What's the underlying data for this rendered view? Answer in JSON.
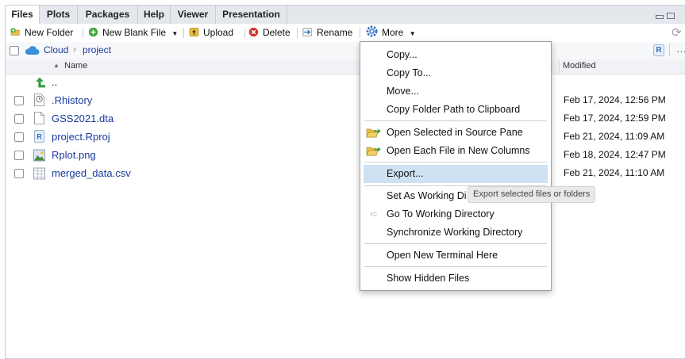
{
  "tabs": [
    "Files",
    "Plots",
    "Packages",
    "Help",
    "Viewer",
    "Presentation"
  ],
  "toolbar": {
    "new_folder": "New Folder",
    "new_blank_file": "New Blank File",
    "upload": "Upload",
    "delete": "Delete",
    "rename": "Rename",
    "more": "More"
  },
  "breadcrumb": {
    "root": "Cloud",
    "separator": "›",
    "current": "project"
  },
  "columns": {
    "name": "Name",
    "modified": "Modified"
  },
  "parent_dir": "..",
  "files": [
    {
      "name": ".Rhistory",
      "modified": "Feb 17, 2024, 12:56 PM",
      "icon": "history-file-icon"
    },
    {
      "name": "GSS2021.dta",
      "modified": "Feb 17, 2024, 12:59 PM",
      "icon": "blank-file-icon"
    },
    {
      "name": "project.Rproj",
      "modified": "Feb 21, 2024, 11:09 AM",
      "icon": "rproj-file-icon"
    },
    {
      "name": "Rplot.png",
      "modified": "Feb 18, 2024, 12:47 PM",
      "icon": "image-file-icon"
    },
    {
      "name": "merged_data.csv",
      "modified": "Feb 21, 2024, 11:10 AM",
      "icon": "csv-file-icon"
    }
  ],
  "menu": {
    "copy": "Copy...",
    "copy_to": "Copy To...",
    "move": "Move...",
    "copy_path": "Copy Folder Path to Clipboard",
    "open_selected": "Open Selected in Source Pane",
    "open_each": "Open Each File in New Columns",
    "export": "Export...",
    "set_wd": "Set As Working Di",
    "go_wd": "Go To Working Directory",
    "sync_wd": "Synchronize Working Directory",
    "open_terminal": "Open New Terminal Here",
    "show_hidden": "Show Hidden Files"
  },
  "tooltip": "Export selected files or folders",
  "colors": {
    "accent_blue": "#1a3a9e",
    "highlight": "#cfe2f3",
    "cloud": "#3a8fd8"
  }
}
